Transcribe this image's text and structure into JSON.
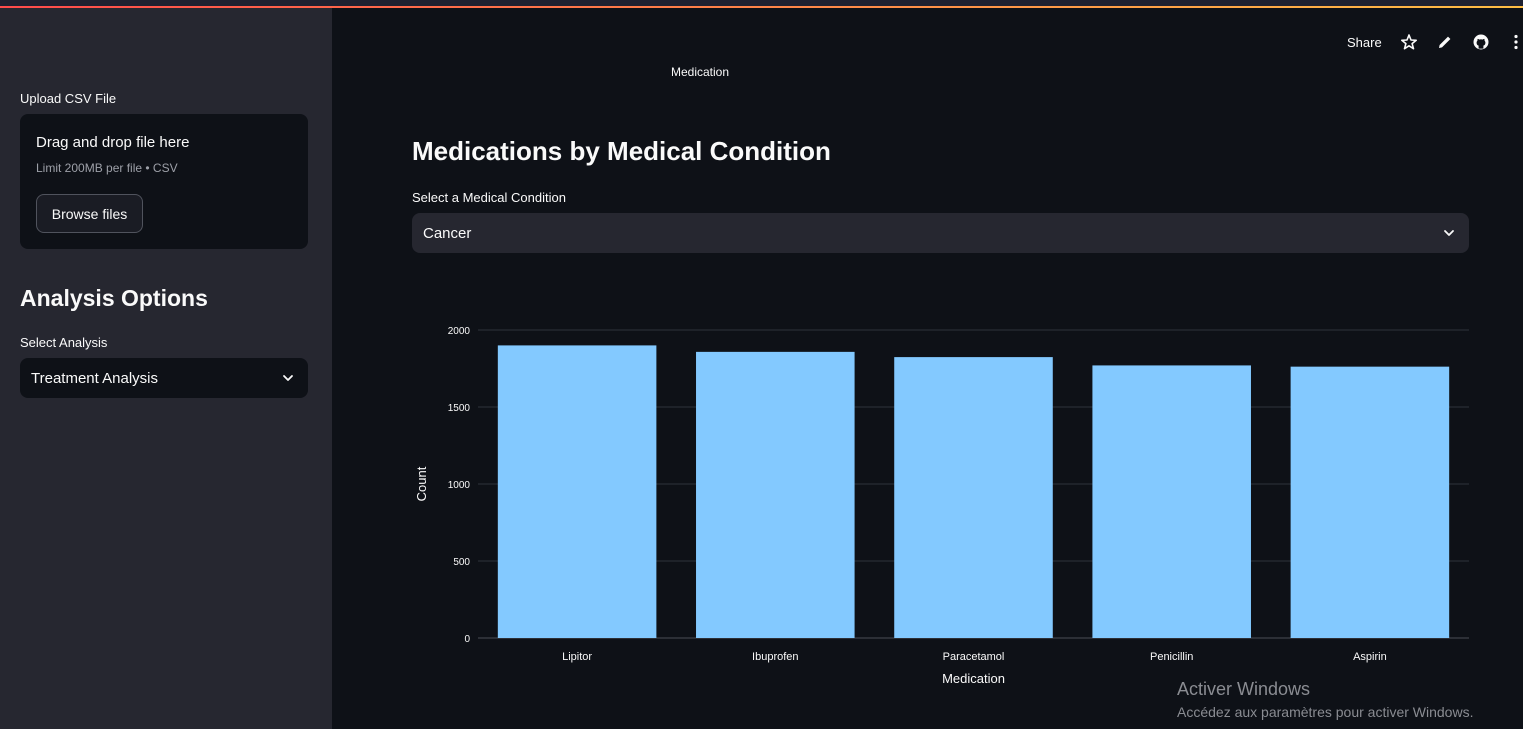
{
  "header": {
    "share_label": "Share",
    "tab_label": "Medication"
  },
  "sidebar": {
    "upload_label": "Upload CSV File",
    "uploader_title": "Drag and drop file here",
    "uploader_hint": "Limit 200MB per file • CSV",
    "browse_label": "Browse files",
    "heading": "Analysis Options",
    "select_label": "Select Analysis",
    "select_value": "Treatment Analysis"
  },
  "main": {
    "title": "Medications by Medical Condition",
    "select_label": "Select a Medical Condition",
    "select_value": "Cancer"
  },
  "watermark": {
    "line1": "Activer Windows",
    "line2": "Accédez aux paramètres pour activer Windows."
  },
  "colors": {
    "bar": "#83c9ff",
    "accent_start": "#ff4b4b",
    "accent_end": "#ffbd45"
  },
  "chart_data": {
    "type": "bar",
    "categories": [
      "Lipitor",
      "Ibuprofen",
      "Paracetamol",
      "Penicillin",
      "Aspirin"
    ],
    "values": [
      1900,
      1858,
      1824,
      1770,
      1762
    ],
    "xlabel": "Medication",
    "ylabel": "Count",
    "ylim": [
      0,
      2000
    ],
    "yticks": [
      0,
      500,
      1000,
      1500,
      2000
    ],
    "grid": true
  }
}
